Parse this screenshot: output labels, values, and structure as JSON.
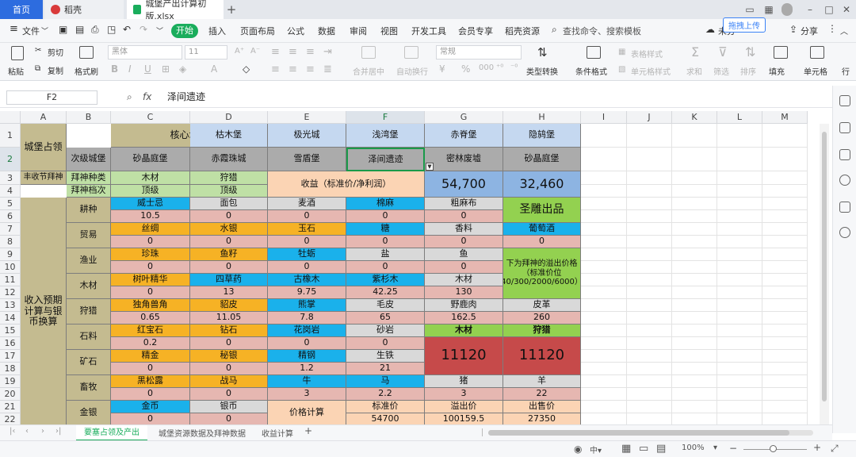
{
  "titlebar": {
    "home": "首页",
    "tab2": "稻壳",
    "tab3": "城堡产出计算初版.xlsx",
    "plus": "+"
  },
  "menu": {
    "file": "文件",
    "start": "开始",
    "items": [
      "插入",
      "页面布局",
      "公式",
      "数据",
      "审阅",
      "视图",
      "开发工具",
      "会员专享",
      "稻壳资源"
    ],
    "search": "查找命令、搜索模板",
    "right1": "未分",
    "share": "分享",
    "upload": "拖拽上传"
  },
  "ribbon": {
    "cut": "剪切",
    "paste": "粘贴",
    "copy": "复制",
    "fmt": "格式刷",
    "font": "黑体",
    "size": "11",
    "merge": "合并居中",
    "wrap": "自动换行",
    "numfmt": "常规",
    "typeconv": "类型转换",
    "condfmt": "条件格式",
    "tablestyle": "表格样式",
    "cellstyle": "单元格样式",
    "sum": "求和",
    "filter": "筛选",
    "sort": "排序",
    "fill": "填充",
    "cell": "单元格",
    "row": "行"
  },
  "formula": {
    "cellref": "F2",
    "fx": "fx",
    "value": "泽间遗迹"
  },
  "columns": [
    "A",
    "B",
    "C",
    "D",
    "E",
    "F",
    "G",
    "H",
    "I",
    "J",
    "K",
    "L",
    "M"
  ],
  "rows": [
    "1",
    "2",
    "3",
    "4",
    "5",
    "6",
    "7",
    "8",
    "9",
    "10",
    "11",
    "12",
    "13",
    "14",
    "15",
    "16",
    "17",
    "18",
    "19",
    "20",
    "21",
    "22",
    "23",
    "24"
  ],
  "cells": {
    "a12": "城堡占领",
    "c1": "核心城堡",
    "d1": "枯木堡",
    "e1": "极光城",
    "f1": "浅湾堡",
    "g1": "赤脊堡",
    "h1": "隐鸫堡",
    "b2": "次级城堡",
    "c2": "砂晶庭堡",
    "d2": "赤霞珠城",
    "e2": "雪盾堡",
    "f2": "泽间遗迹",
    "g2": "密林废墟",
    "h2": "砂晶庭堡",
    "a3": "丰收节拜神",
    "b3": "拜神种类",
    "c3": "木材",
    "d3": "狩猎",
    "e34": "收益（标准价/净利润）",
    "g34": "54,700",
    "h34": "32,460",
    "b4": "拜神档次",
    "c4": "顶级",
    "d4": "顶级",
    "a522": "收入预期计算与银币换算",
    "b56": "耕种",
    "b78": "贸易",
    "b910": "渔业",
    "b1112": "木材",
    "b1314": "狩猎",
    "b1516": "石料",
    "b1718": "矿石",
    "b1920": "畜牧",
    "b2122": "金银",
    "c5": "威士忌",
    "d5": "面包",
    "e5": "麦酒",
    "f5": "棉麻",
    "g5": "粗麻布",
    "h56": "圣雕出品",
    "c6": "10.5",
    "d6": "0",
    "e6": "0",
    "f6": "0",
    "g6": "0",
    "c7": "丝绸",
    "d7": "水银",
    "e7": "玉石",
    "f7": "糖",
    "g7": "香料",
    "h7": "葡萄酒",
    "c8": "0",
    "d8": "0",
    "e8": "0",
    "f8": "0",
    "g8": "0",
    "h8": "0",
    "c9": "珍珠",
    "d9": "鱼籽",
    "e9": "牡蛎",
    "f9": "盐",
    "g9": "鱼",
    "h912": "下为拜神的溢出价格（标准价位40/300/2000/6000）",
    "c10": "0",
    "d10": "0",
    "e10": "0",
    "f10": "0",
    "g10": "0",
    "c11": "树叶精华",
    "d11": "四草药",
    "e11": "古橡木",
    "f11": "紫杉木",
    "g11": "木材",
    "c12": "0",
    "d12": "13",
    "e12": "9.75",
    "f12": "42.25",
    "g12": "130",
    "c13": "独角兽角",
    "d13": "貂皮",
    "e13": "熊掌",
    "f13": "毛皮",
    "g13": "野鹿肉",
    "h13": "皮革",
    "c14": "0.65",
    "d14": "11.05",
    "e14": "7.8",
    "f14": "65",
    "g14": "162.5",
    "h14": "260",
    "c15": "红宝石",
    "d15": "钻石",
    "e15": "花岗岩",
    "f15": "砂岩",
    "g15": "木材",
    "h15": "狩猎",
    "c16": "0.2",
    "d16": "0",
    "e16": "0",
    "f16": "0",
    "g1618": "11120",
    "h1618": "11120",
    "c17": "精金",
    "d17": "秘银",
    "e17": "精钢",
    "f17": "生铁",
    "c18": "0",
    "d18": "0",
    "e18": "1.2",
    "f18": "21",
    "c19": "黑松露",
    "d19": "战马",
    "e19": "牛",
    "f19": "马",
    "g19": "猪",
    "h19": "羊",
    "c20": "0",
    "d20": "0",
    "e20": "3",
    "f20": "2.2",
    "g20": "3",
    "h20": "22",
    "c21": "金币",
    "d21": "银币",
    "e2122": "价格计算",
    "f21": "标准价",
    "g21": "溢出价",
    "h21": "出售价",
    "c22": "0",
    "d22": "0",
    "f22": "54700",
    "g22": "100159.5",
    "h22": "27350"
  },
  "sheets": {
    "s1": "要塞占领及产出",
    "s2": "城堡资源数据及拜神数据",
    "s3": "收益计算",
    "add": "+"
  },
  "status": {
    "zoom": "100%",
    "zoomminus": "−",
    "zoomplus": "+",
    "ch": "中"
  },
  "colors": {
    "accent": "#1aad5c",
    "home": "#2d6cdf"
  }
}
